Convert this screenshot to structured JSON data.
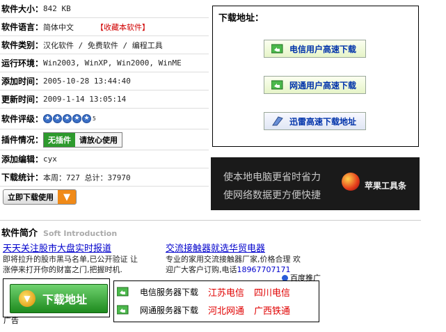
{
  "info": {
    "size_label": "软件大小：",
    "size_value": "842 KB",
    "lang_label": "软件语言：",
    "lang_value": "简体中文",
    "favorite": "【收藏本软件】",
    "category_label": "软件类别：",
    "category_value": "汉化软件 / 免费软件 / 编程工具",
    "env_label": "运行环境：",
    "env_value": "Win2003, WinXP, Win2000, WinME",
    "added_label": "添加时间：",
    "added_value": "2005-10-28 13:44:40",
    "updated_label": "更新时间：",
    "updated_value": "2009-1-14 13:05:14",
    "rating_label": "软件评级：",
    "rating_value": "5",
    "rating_stars": 5,
    "plugin_label": "插件情况：",
    "plugin_badge": "无插件",
    "plugin_text": "请放心使用",
    "editor_label": "添加编辑：",
    "editor_value": "cyx",
    "stats_label": "下载统计：",
    "stats_value": "本周：727 总计：37970",
    "download_now": "立即下载使用"
  },
  "download_box": {
    "title": "下载地址：",
    "buttons": [
      "电信用户高速下载",
      "网通用户高速下载",
      "迅雷高速下载地址"
    ]
  },
  "banner": {
    "line1": "使本地电脑更省时省力",
    "line2": "使网络数据更方便快捷",
    "brand": "苹果工具条"
  },
  "intro": {
    "cn": "软件简介",
    "en": "Soft Introduction"
  },
  "ads": [
    {
      "headline": "天天关注股市大盘实时报道",
      "desc1": "即将拉升的股市黑马名单,已公开验证 让",
      "desc2": "涨停来打开你的财富之门,把握时机."
    },
    {
      "headline": "交流接触器就选华贸电器",
      "desc1": "专业的家用交流接触器厂家,价格合理 欢",
      "desc2": "迎广大客户订购,电话",
      "phone": "18967707171"
    }
  ],
  "baidu": "百度推广",
  "big_download": "下载地址",
  "ad_label": "广告",
  "servers": [
    {
      "label": "电信服务器下载",
      "links": [
        "江苏电信",
        "四川电信"
      ]
    },
    {
      "label": "网通服务器下载",
      "links": [
        "河北网通",
        "广西铁通"
      ]
    }
  ],
  "colors": {
    "accent_red": "#e00000",
    "link_blue": "#0000cc",
    "green": "#2d9a2d",
    "orange": "#f08a18"
  }
}
